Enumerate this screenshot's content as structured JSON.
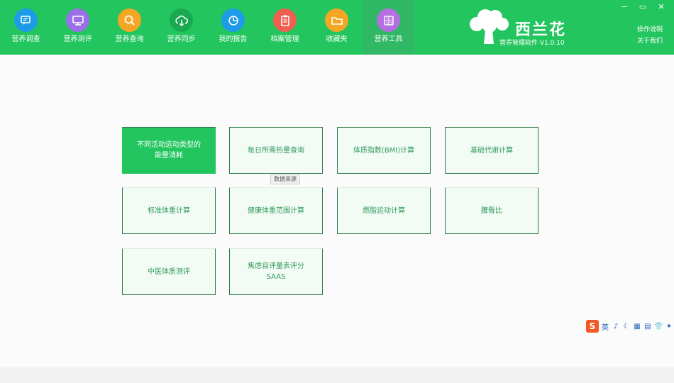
{
  "nav": {
    "items": [
      {
        "label": "营养调查",
        "icon": "survey-icon",
        "color": "#1e9be8"
      },
      {
        "label": "营养测评",
        "icon": "monitor-icon",
        "color": "#9b6fe8"
      },
      {
        "label": "营养查询",
        "icon": "search-icon",
        "color": "#f5a623"
      },
      {
        "label": "营养同步",
        "icon": "cloud-sync-icon",
        "color": "#1aa850"
      },
      {
        "label": "我的报告",
        "icon": "report-chart-icon",
        "color": "#1e9be8"
      },
      {
        "label": "档案管理",
        "icon": "clipboard-icon",
        "color": "#f06050"
      },
      {
        "label": "收藏夹",
        "icon": "folder-icon",
        "color": "#f5a623"
      },
      {
        "label": "营养工具",
        "icon": "calculator-icon",
        "color": "#b46fe0"
      }
    ],
    "active_index": 7
  },
  "logo": {
    "title": "西兰花",
    "subtitle": "营养管理软件 V1.0.10"
  },
  "window": {
    "minimize": "−",
    "maximize": "▭",
    "close": "✕"
  },
  "top_links": {
    "operation_guide": "操作说明",
    "about_us": "关于我们"
  },
  "tools": [
    {
      "label": "不同活动运动类型的能量消耗",
      "active": true
    },
    {
      "label": "每日所需热量查询",
      "active": false
    },
    {
      "label": "体质指数(BMI)计算",
      "active": false
    },
    {
      "label": "基础代谢计算",
      "active": false
    },
    {
      "label": "标准体重计算",
      "active": false
    },
    {
      "label": "健康体重范围计算",
      "active": false
    },
    {
      "label": "燃脂运动计算",
      "active": false
    },
    {
      "label": "腰臀比",
      "active": false
    },
    {
      "label": "中医体质测评",
      "active": false
    },
    {
      "label": "焦虑自评量表评分SAAS",
      "active": false
    }
  ],
  "tooltip": "数据来源",
  "ime": {
    "logo": "S",
    "items": [
      "英",
      "♪",
      "☾",
      "▦",
      "▤",
      "👕",
      "✦"
    ]
  },
  "colors": {
    "brand_green": "#22c55e",
    "card_text": "#2f9a5b"
  }
}
